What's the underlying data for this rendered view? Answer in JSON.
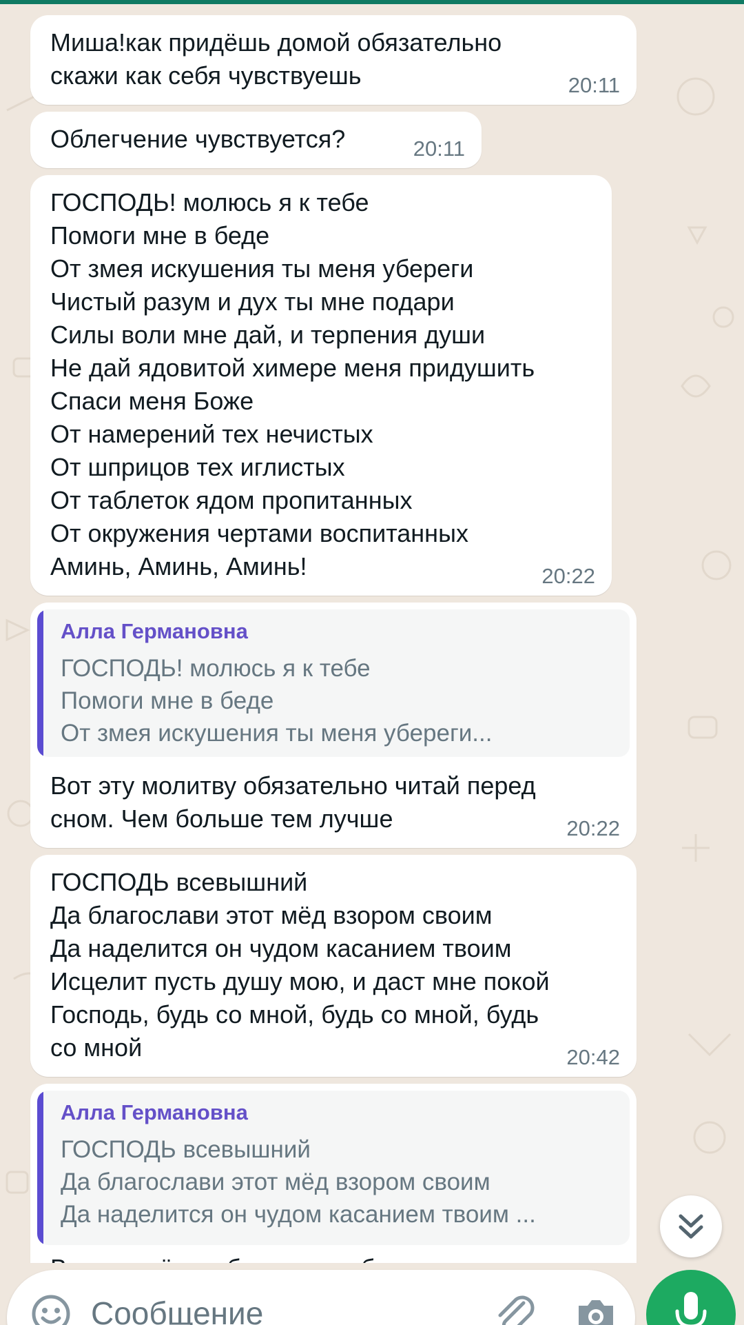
{
  "messages": [
    {
      "text": "Миша!как придёшь домой обязательно\nскажи как себя чувствуешь",
      "time": "20:11"
    },
    {
      "text": "Облегчение чувствуется?",
      "time": "20:11"
    },
    {
      "text": "ГОСПОДЬ! молюсь я к тебе\nПомоги мне в беде\nОт змея искушения ты меня убереги\nЧистый разум и дух ты мне подари\nСилы воли мне дай, и терпения души\nНе дай ядовитой химере меня придушить\nСпаси меня Боже\nОт намерений тех нечистых\nОт шприцов тех иглистых\nОт таблеток ядом пропитанных\nОт окружения чертами воспитанных\nАминь, Аминь, Аминь!",
      "time": "20:22"
    },
    {
      "quote": {
        "author": "Алла Германовна",
        "text": "ГОСПОДЬ! молюсь я к тебе\nПомоги мне в беде\nОт змея искушения ты меня убереги..."
      },
      "text": "Вот эту молитву обязательно читай перед\nсном. Чем больше тем лучше",
      "time": "20:22"
    },
    {
      "text": "ГОСПОДЬ всевышний\nДа благослави этот мёд взором своим\nДа наделится он чудом касанием твоим\nИсцелит пусть душу мою, и даст мне покой\nГосподь, будь со мной, будь со мной, будь\nсо мной",
      "time": "20:42"
    },
    {
      "quote": {
        "author": "Алла Германовна",
        "text": "ГОСПОДЬ всевышний\nДа благослави этот мёд взором своим\nДа наделится он чудом касанием твоим ..."
      },
      "text": "Возьми мёд из баночки, добавь капли"
    }
  ],
  "composer": {
    "placeholder": "Сообщение",
    "icons": [
      "emoji-icon",
      "attach-icon",
      "camera-icon",
      "mic-icon"
    ]
  },
  "scroll_down_icon": "chevron-double-down-icon",
  "colors": {
    "top_bar": "#0f7a63",
    "background": "#efe7de",
    "bubble": "#ffffff",
    "quote_bar": "#5b4cd1",
    "quote_author": "#6450c8",
    "timestamp": "#667781",
    "mic_button": "#1daa61"
  }
}
